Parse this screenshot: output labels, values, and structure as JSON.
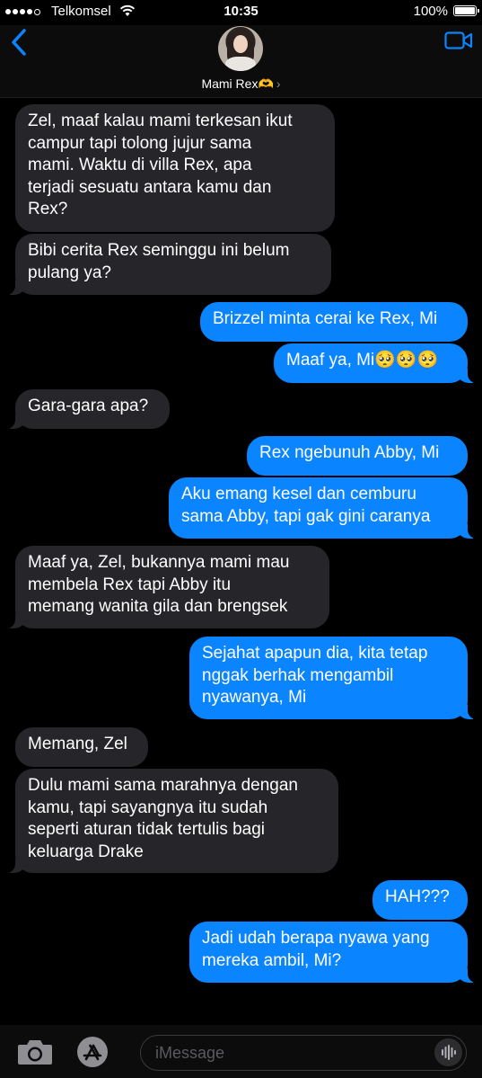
{
  "status_bar": {
    "carrier": "Telkomsel",
    "time": "10:35",
    "battery": "100%"
  },
  "header": {
    "contact_name": "Mami Rex🫶",
    "chevron": "›"
  },
  "messages": [
    {
      "side": "in",
      "text": "Zel, maaf kalau mami terkesan ikut\ncampur tapi tolong jujur sama\nmami. Waktu di villa Rex, apa\nterjadi sesuatu antara kamu dan\nRex?"
    },
    {
      "side": "in",
      "text": "Bibi cerita Rex seminggu ini belum\npulang ya?"
    },
    {
      "side": "out",
      "text": "Brizzel minta cerai ke Rex, Mi"
    },
    {
      "side": "out",
      "text": "Maaf ya, Mi🥺🥺🥺"
    },
    {
      "side": "in",
      "text": "Gara-gara apa?"
    },
    {
      "side": "out",
      "text": "Rex ngebunuh Abby, Mi"
    },
    {
      "side": "out",
      "text": "Aku emang kesel dan cemburu\nsama Abby, tapi gak gini caranya"
    },
    {
      "side": "in",
      "text": "Maaf ya, Zel, bukannya mami mau\nmembela Rex tapi Abby itu\nmemang wanita gila dan brengsek"
    },
    {
      "side": "out",
      "text": "Sejahat apapun dia, kita tetap\nnggak berhak mengambil\nnyawanya, Mi"
    },
    {
      "side": "in",
      "text": "Memang, Zel"
    },
    {
      "side": "in",
      "text": "Dulu mami sama marahnya dengan\nkamu, tapi sayangnya itu sudah\nseperti aturan tidak tertulis bagi\nkeluarga Drake"
    },
    {
      "side": "out",
      "text": "HAH???"
    },
    {
      "side": "out",
      "text": "Jadi udah berapa nyawa yang\nmereka ambil, Mi?"
    }
  ],
  "input": {
    "placeholder": "iMessage"
  },
  "colors": {
    "outgoing_bubble": "#0a84ff",
    "incoming_bubble": "#26252a",
    "accent": "#0a84ff"
  },
  "icons": [
    "back-chevron-icon",
    "video-call-icon",
    "camera-icon",
    "app-store-icon",
    "audio-message-icon",
    "wifi-icon",
    "battery-icon"
  ]
}
